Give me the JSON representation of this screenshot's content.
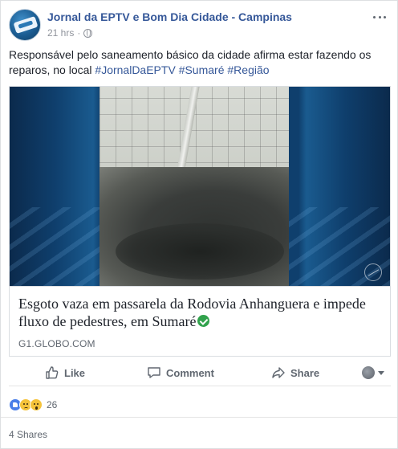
{
  "post": {
    "page_name": "Jornal da EPTV e Bom Dia Cidade - Campinas",
    "timestamp": "21 hrs",
    "separator": "·",
    "privacy_icon": "globe-icon",
    "text": "Responsável pelo saneamento básico da cidade afirma estar fazendo os reparos, no local",
    "hashtags": [
      "#JornalDaEPTV",
      "#Sumaré",
      "#Região"
    ]
  },
  "link_preview": {
    "title": "Esgoto vaza em passarela da Rodovia Anhanguera e impede fluxo de pedestres, em Sumaré",
    "domain": "G1.GLOBO.COM"
  },
  "actions": {
    "like": "Like",
    "comment": "Comment",
    "share": "Share"
  },
  "reactions": {
    "icons": [
      "like-icon",
      "sad-icon",
      "wow-icon"
    ],
    "count": "26"
  },
  "shares_text": "4 Shares",
  "colors": {
    "link_blue": "#365899",
    "secondary_text": "#606770",
    "verified_green": "#31a24c"
  }
}
